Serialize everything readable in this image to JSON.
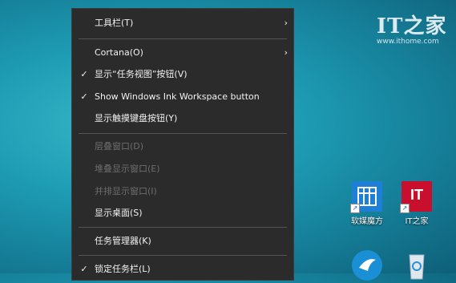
{
  "context_menu": {
    "items": [
      {
        "label": "工具栏(T)",
        "checked": false,
        "disabled": false,
        "submenu": true
      },
      {
        "label": "Cortana(O)",
        "checked": false,
        "disabled": false,
        "submenu": true
      },
      {
        "label": "显示“任务视图”按钮(V)",
        "checked": true,
        "disabled": false,
        "submenu": false
      },
      {
        "label": "Show Windows Ink Workspace button",
        "checked": true,
        "disabled": false,
        "submenu": false
      },
      {
        "label": "显示触摸键盘按钮(Y)",
        "checked": false,
        "disabled": false,
        "submenu": false
      },
      {
        "label": "层叠窗口(D)",
        "checked": false,
        "disabled": true,
        "submenu": false
      },
      {
        "label": "堆叠显示窗口(E)",
        "checked": false,
        "disabled": true,
        "submenu": false
      },
      {
        "label": "并排显示窗口(I)",
        "checked": false,
        "disabled": true,
        "submenu": false
      },
      {
        "label": "显示桌面(S)",
        "checked": false,
        "disabled": false,
        "submenu": false
      },
      {
        "label": "任务管理器(K)",
        "checked": false,
        "disabled": false,
        "submenu": false
      },
      {
        "label": "锁定任务栏(L)",
        "checked": true,
        "disabled": false,
        "submenu": false
      }
    ],
    "check_glyph": "✓",
    "submenu_glyph": "›"
  },
  "watermark": {
    "logo": "IT之家",
    "url": "www.ithome.com"
  },
  "desktop_icons": [
    {
      "label": "软媒魔方",
      "icon": "ruanmei-cube-icon",
      "color": "#1e7fd6"
    },
    {
      "label": "IT之家",
      "icon": "ithome-icon",
      "color": "#c8102e",
      "text": "IT"
    },
    {
      "label": "",
      "icon": "bird-app-icon",
      "color": "#1a8fd6"
    },
    {
      "label": "",
      "icon": "recycle-bin-icon",
      "color": "#dfe8ee"
    }
  ]
}
